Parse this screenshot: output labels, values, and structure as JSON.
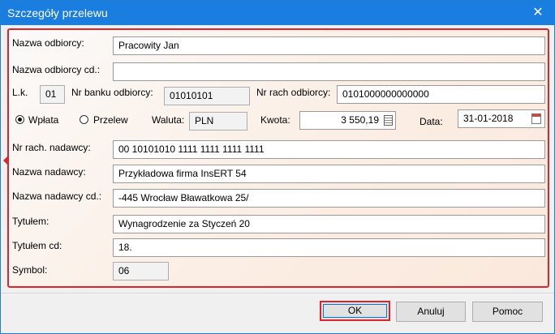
{
  "window": {
    "title": "Szczegóły przelewu"
  },
  "icons": {
    "close": "close-icon",
    "calculator": "calculator-icon",
    "calendar": "calendar-icon"
  },
  "fields": {
    "recipient_name": {
      "label": "Nazwa odbiorcy:",
      "value": "Pracowity Jan"
    },
    "recipient_name_cont": {
      "label": "Nazwa odbiorcy cd.:",
      "value": ""
    },
    "lk": {
      "label": "L.k.",
      "value": "01"
    },
    "bank_no": {
      "label": "Nr banku odbiorcy:",
      "value": "01010101"
    },
    "account_no": {
      "label": "Nr rach odbiorcy:",
      "value": "0101000000000000"
    },
    "type": {
      "options": [
        "Wpłata",
        "Przelew"
      ],
      "selected": "Wpłata"
    },
    "currency": {
      "label": "Waluta:",
      "value": "PLN"
    },
    "amount": {
      "label": "Kwota:",
      "value": "3 550,19"
    },
    "date": {
      "label": "Data:",
      "value": "31-01-2018"
    },
    "sender_account": {
      "label": "Nr rach. nadawcy:",
      "value": "00 10101010 1111 1111 1111 1111"
    },
    "sender_name": {
      "label": "Nazwa nadawcy:",
      "value": "Przykładowa firma InsERT 54"
    },
    "sender_name_cont": {
      "label": "Nazwa nadawcy cd.:",
      "value": "-445 Wrocław Bławatkowa 25/"
    },
    "title": {
      "label": "Tytułem:",
      "value": "Wynagrodzenie za Styczeń 20"
    },
    "title_cont": {
      "label": "Tytułem cd:",
      "value": "18."
    },
    "symbol": {
      "label": "Symbol:",
      "value": "06"
    }
  },
  "buttons": {
    "ok": "OK",
    "cancel": "Anuluj",
    "help": "Pomoc"
  },
  "colors": {
    "titlebar": "#1a7ee0",
    "highlight": "#d9262c"
  }
}
